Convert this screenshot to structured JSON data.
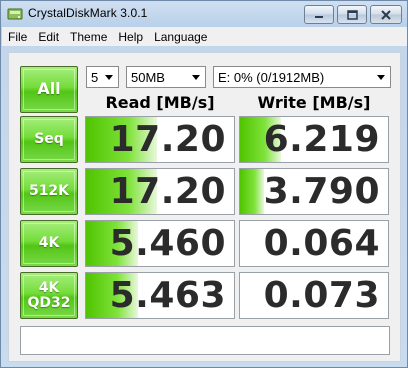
{
  "window": {
    "title": "CrystalDiskMark 3.0.1"
  },
  "menu": [
    "File",
    "Edit",
    "Theme",
    "Help",
    "Language"
  ],
  "controls": {
    "all_label": "All",
    "count_value": "5",
    "size_value": "50MB",
    "drive_value": "E: 0% (0/1912MB)"
  },
  "headers": {
    "read": "Read [MB/s]",
    "write": "Write [MB/s]"
  },
  "rows": [
    {
      "label": "Seq",
      "read": "17.20",
      "write": "6.219",
      "read_fill": 0.48,
      "write_fill": 0.28
    },
    {
      "label": "512K",
      "read": "17.20",
      "write": "3.790",
      "read_fill": 0.48,
      "write_fill": 0.16
    },
    {
      "label": "4K",
      "read": "5.460",
      "write": "0.064",
      "read_fill": 0.35,
      "write_fill": 0.0
    },
    {
      "label": "4K\nQD32",
      "read": "5.463",
      "write": "0.073",
      "read_fill": 0.35,
      "write_fill": 0.0
    }
  ],
  "status_text": "",
  "colors": {
    "accent_green": "#52c516",
    "window_frame": "#b9d0ea",
    "value_text": "#2b2b2b"
  }
}
